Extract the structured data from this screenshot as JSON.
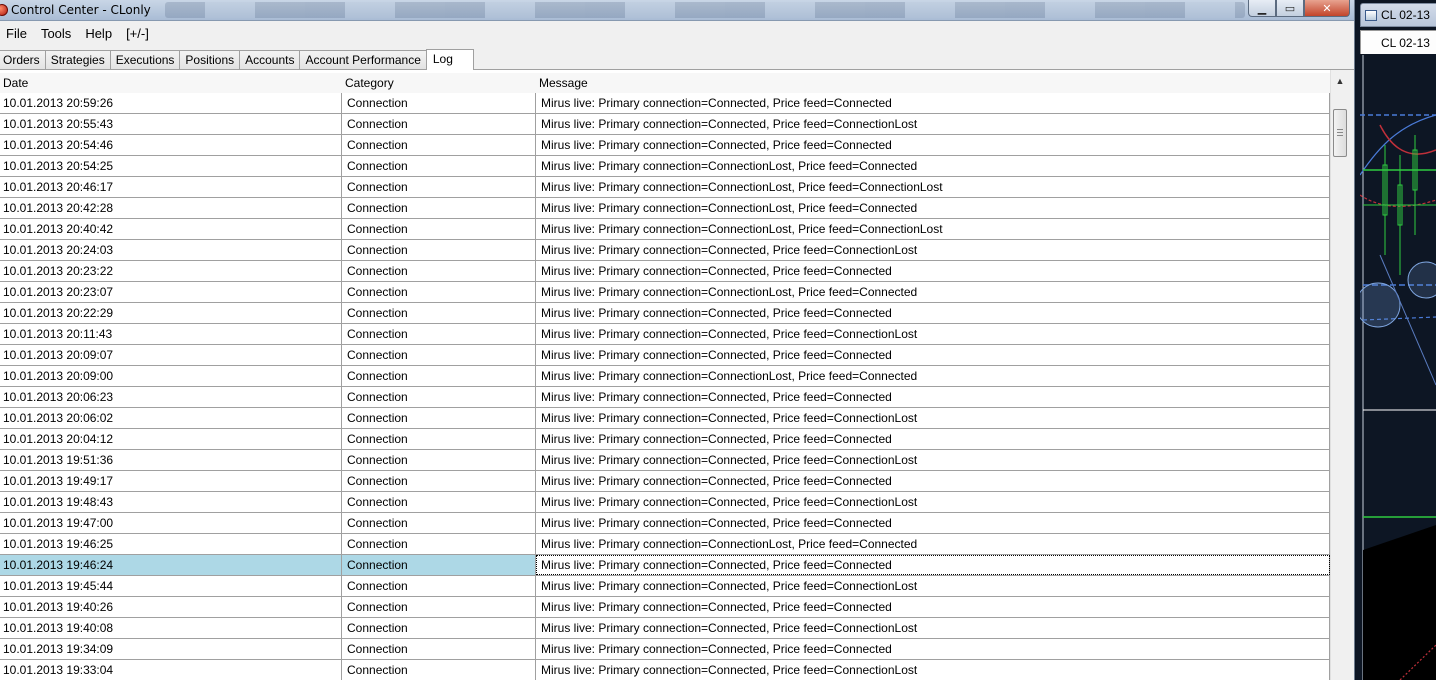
{
  "window": {
    "title": "Control Center - CLonly",
    "controls": {
      "minimize": "▁",
      "maximize": "▭",
      "close": "✕"
    }
  },
  "menu": [
    {
      "label": "File"
    },
    {
      "label": "Tools"
    },
    {
      "label": "Help"
    },
    {
      "label": "[+/-]"
    }
  ],
  "tabs": [
    {
      "label": "Orders"
    },
    {
      "label": "Strategies"
    },
    {
      "label": "Executions"
    },
    {
      "label": "Positions"
    },
    {
      "label": "Accounts"
    },
    {
      "label": "Account Performance"
    },
    {
      "label": "Log",
      "active": true
    }
  ],
  "grid": {
    "columns": {
      "date": "Date",
      "category": "Category",
      "message": "Message"
    },
    "selected_index": 22,
    "rows": [
      {
        "date": "10.01.2013 20:59:26",
        "category": "Connection",
        "message": "Mirus live: Primary connection=Connected, Price feed=Connected"
      },
      {
        "date": "10.01.2013 20:55:43",
        "category": "Connection",
        "message": "Mirus live: Primary connection=Connected, Price feed=ConnectionLost"
      },
      {
        "date": "10.01.2013 20:54:46",
        "category": "Connection",
        "message": "Mirus live: Primary connection=Connected, Price feed=Connected"
      },
      {
        "date": "10.01.2013 20:54:25",
        "category": "Connection",
        "message": "Mirus live: Primary connection=ConnectionLost, Price feed=Connected"
      },
      {
        "date": "10.01.2013 20:46:17",
        "category": "Connection",
        "message": "Mirus live: Primary connection=ConnectionLost, Price feed=ConnectionLost"
      },
      {
        "date": "10.01.2013 20:42:28",
        "category": "Connection",
        "message": "Mirus live: Primary connection=ConnectionLost, Price feed=Connected"
      },
      {
        "date": "10.01.2013 20:40:42",
        "category": "Connection",
        "message": "Mirus live: Primary connection=ConnectionLost, Price feed=ConnectionLost"
      },
      {
        "date": "10.01.2013 20:24:03",
        "category": "Connection",
        "message": "Mirus live: Primary connection=Connected, Price feed=ConnectionLost"
      },
      {
        "date": "10.01.2013 20:23:22",
        "category": "Connection",
        "message": "Mirus live: Primary connection=Connected, Price feed=Connected"
      },
      {
        "date": "10.01.2013 20:23:07",
        "category": "Connection",
        "message": "Mirus live: Primary connection=ConnectionLost, Price feed=Connected"
      },
      {
        "date": "10.01.2013 20:22:29",
        "category": "Connection",
        "message": "Mirus live: Primary connection=Connected, Price feed=Connected"
      },
      {
        "date": "10.01.2013 20:11:43",
        "category": "Connection",
        "message": "Mirus live: Primary connection=Connected, Price feed=ConnectionLost"
      },
      {
        "date": "10.01.2013 20:09:07",
        "category": "Connection",
        "message": "Mirus live: Primary connection=Connected, Price feed=Connected"
      },
      {
        "date": "10.01.2013 20:09:00",
        "category": "Connection",
        "message": "Mirus live: Primary connection=ConnectionLost, Price feed=Connected"
      },
      {
        "date": "10.01.2013 20:06:23",
        "category": "Connection",
        "message": "Mirus live: Primary connection=Connected, Price feed=Connected"
      },
      {
        "date": "10.01.2013 20:06:02",
        "category": "Connection",
        "message": "Mirus live: Primary connection=Connected, Price feed=ConnectionLost"
      },
      {
        "date": "10.01.2013 20:04:12",
        "category": "Connection",
        "message": "Mirus live: Primary connection=Connected, Price feed=Connected"
      },
      {
        "date": "10.01.2013 19:51:36",
        "category": "Connection",
        "message": "Mirus live: Primary connection=Connected, Price feed=ConnectionLost"
      },
      {
        "date": "10.01.2013 19:49:17",
        "category": "Connection",
        "message": "Mirus live: Primary connection=Connected, Price feed=Connected"
      },
      {
        "date": "10.01.2013 19:48:43",
        "category": "Connection",
        "message": "Mirus live: Primary connection=Connected, Price feed=ConnectionLost"
      },
      {
        "date": "10.01.2013 19:47:00",
        "category": "Connection",
        "message": "Mirus live: Primary connection=Connected, Price feed=Connected"
      },
      {
        "date": "10.01.2013 19:46:25",
        "category": "Connection",
        "message": "Mirus live: Primary connection=ConnectionLost, Price feed=Connected"
      },
      {
        "date": "10.01.2013 19:46:24",
        "category": "Connection",
        "message": "Mirus live: Primary connection=Connected, Price feed=Connected"
      },
      {
        "date": "10.01.2013 19:45:44",
        "category": "Connection",
        "message": "Mirus live: Primary connection=Connected, Price feed=ConnectionLost"
      },
      {
        "date": "10.01.2013 19:40:26",
        "category": "Connection",
        "message": "Mirus live: Primary connection=Connected, Price feed=Connected"
      },
      {
        "date": "10.01.2013 19:40:08",
        "category": "Connection",
        "message": "Mirus live: Primary connection=Connected, Price feed=ConnectionLost"
      },
      {
        "date": "10.01.2013 19:34:09",
        "category": "Connection",
        "message": "Mirus live: Primary connection=Connected, Price feed=Connected"
      },
      {
        "date": "10.01.2013 19:33:04",
        "category": "Connection",
        "message": "Mirus live: Primary connection=Connected, Price feed=ConnectionLost"
      }
    ]
  },
  "scrollbar": {
    "up_arrow": "▲"
  },
  "chart_window": {
    "title": "CL 02-13",
    "tab_label": "CL 02-13",
    "colors": {
      "background": "#0d1624",
      "line_blue": "#4a7bd8",
      "line_red": "#c0303a",
      "line_green": "#2ecc40",
      "accent_white": "#ffffff"
    }
  },
  "colors": {
    "selection": "#add8e6",
    "grid_line": "#a0a0a0",
    "window_bg": "#f0f0f0"
  }
}
